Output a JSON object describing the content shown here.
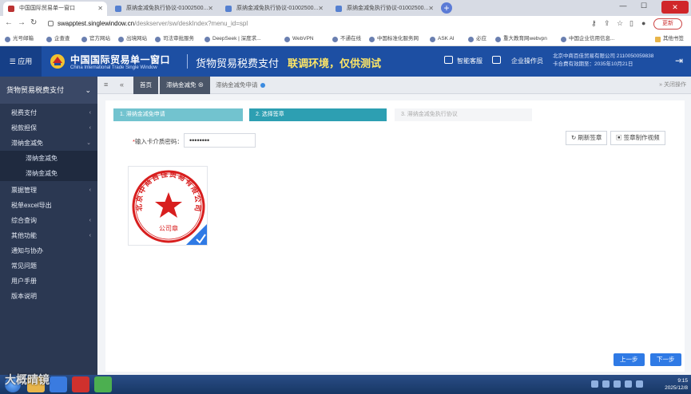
{
  "browser": {
    "tabs": [
      {
        "label": "中国国际贸易单一窗口"
      },
      {
        "label": "原纳金减免执行协议-01002500..."
      },
      {
        "label": "原纳金减免执行协议-01002500..."
      },
      {
        "label": "原纳金减免执行协议-01002500..."
      }
    ],
    "url_host": "swapptest.singlewindow.cn",
    "url_path": "/deskserver/sw/deskIndex?menu_id=spl",
    "update_label": "更新",
    "bookmarks": [
      "光号邮箱",
      "企查查",
      "官方网站",
      "出境网站",
      "司法审批服务",
      "DeepSeek | 深度求...",
      "WebVPN",
      "不通在线",
      "中国标准化服务网",
      "ASK AI",
      "必应",
      "重大教育网webvpn",
      "中国企业信用信息...",
      "其他书签"
    ]
  },
  "header": {
    "menu_label": "应用",
    "brand_cn": "中国国际贸易单一窗口",
    "brand_en": "China International Trade Single Window",
    "app_name": "货物贸易税费支付",
    "test_note": "联调环境，仅供测试",
    "service_label": "智能客服",
    "operator_label": "企业操作员",
    "company_line1": "北京中商百佳贸易有限公司 2110050059838",
    "company_line2": "卡合费有效期至：2035年10月21日"
  },
  "sidebar": {
    "title": "货物贸易税费支付",
    "items": [
      {
        "label": "税费支付"
      },
      {
        "label": "税款担保"
      },
      {
        "label": "滞纳金减免"
      },
      {
        "label": "滞纳金减免"
      },
      {
        "label": "滞纳金减免"
      },
      {
        "label": "票据管理"
      },
      {
        "label": "税单excel导出"
      },
      {
        "label": "综合查询"
      },
      {
        "label": "其他功能"
      },
      {
        "label": "通知与协办"
      },
      {
        "label": "常见问题"
      },
      {
        "label": "用户手册"
      },
      {
        "label": "版本说明"
      }
    ]
  },
  "content": {
    "tabs": {
      "home": "首页",
      "t2": "滞纳金减免",
      "t3": "滞纳金减免申请"
    },
    "close_others": "关闭操作",
    "steps": [
      "1. 滞纳金减免申请",
      "2. 选择签章",
      "3. 滞纳金减免执行协议"
    ],
    "password_label": "输入卡介质密码：",
    "password_value": "••••••••",
    "refresh_label": "刷新签章",
    "tutorial_label": "签章制作视频",
    "seal_text_ring": "北京中商百佳贸易有限公司",
    "seal_text_bottom": "公司章",
    "prev_label": "上一步",
    "next_label": "下一步"
  },
  "taskbar": {
    "time": "9:15",
    "date": "2025/12/8"
  },
  "watermark": "大概晴镜",
  "colors": {
    "header_blue": "#1d4fa3",
    "sidebar_dark": "#2b3852",
    "step_active": "#2d9fb2",
    "primary": "#2f7ae5",
    "seal_red": "#d81e1e"
  }
}
